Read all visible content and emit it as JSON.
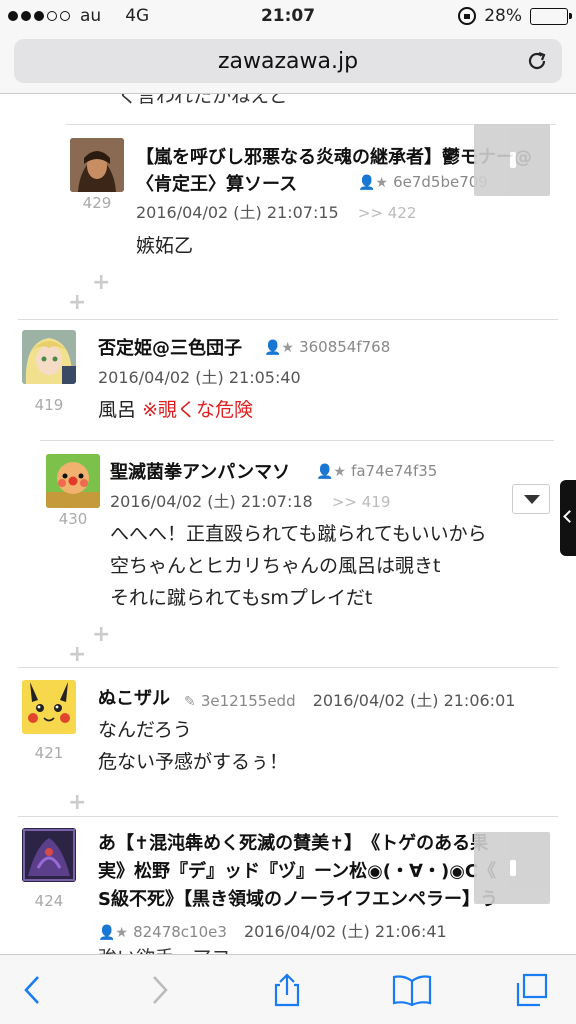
{
  "status": {
    "carrier": "au",
    "network": "4G",
    "time": "21:07",
    "battery": "28%",
    "battery_level": 0.28
  },
  "browser": {
    "url": "zawazawa.jp"
  },
  "partial_top_text": "く言われたかねえど",
  "comments": [
    {
      "number": "429",
      "author": "【嵐を呼びし邪悪なる炎魂の継承者】鬱モナー@〈肯定王〉算ソース",
      "user_id": "6e7d5be709",
      "date": "2016/04/02 (土) 21:07:15",
      "reply_to": ">> 422",
      "text": "嫉妬乙"
    },
    {
      "number": "419",
      "author": "否定姫@三色団子",
      "user_id": "360854f768",
      "date": "2016/04/02 (土) 21:05:40",
      "text": "風呂",
      "warning": "※覗くな危険"
    },
    {
      "number": "430",
      "author": "聖滅菌拳アンパンマソ",
      "user_id": "fa74e74f35",
      "date": "2016/04/02 (土) 21:07:18",
      "reply_to": ">> 419",
      "lines": [
        "へへへ！正直殴られても蹴られてもいいから",
        "空ちゃんとヒカリちゃんの風呂は覗きt",
        "それに蹴られてもsmプレイだt"
      ]
    },
    {
      "number": "421",
      "author": "ぬこザル",
      "user_id": "3e12155edd",
      "date": "2016/04/02 (土) 21:06:01",
      "lines": [
        "なんだろう",
        "危ない予感がするぅ！"
      ]
    },
    {
      "number": "424",
      "author_lines": [
        "あ【✝混沌犇めく死滅の賛美✝】　《トゲのある果",
        "実》松野『デ』ッド『ヅ』ーン松◉(・∀・)◉C《",
        "S級不死》【黒き領域のノーライフエンペラー】う"
      ],
      "user_id": "82478c10e3",
      "date": "2016/04/02 (土) 21:06:41",
      "partial_text": "強い欲手ーアコ"
    }
  ],
  "plus_symbol": "+"
}
